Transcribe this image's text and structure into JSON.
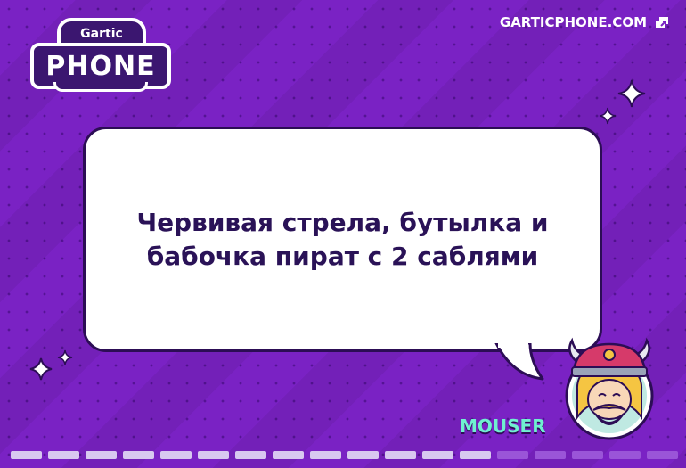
{
  "logo": {
    "top": "Gartic",
    "main": "PHONE"
  },
  "site": {
    "label": "GARTICPHONE.COM"
  },
  "prompt": {
    "text": "Червивая стрела, бутылка и бабочка пират с 2 саблями"
  },
  "player": {
    "name": "MOUSER"
  },
  "progress": {
    "completed": 13,
    "total": 18
  },
  "icons": {
    "site": "fullscreen-icon",
    "sparkle": "sparkle-icon"
  },
  "colors": {
    "background": "#7a22c4",
    "bubble_border": "#2c0d55",
    "username": "#6ff0d0"
  }
}
